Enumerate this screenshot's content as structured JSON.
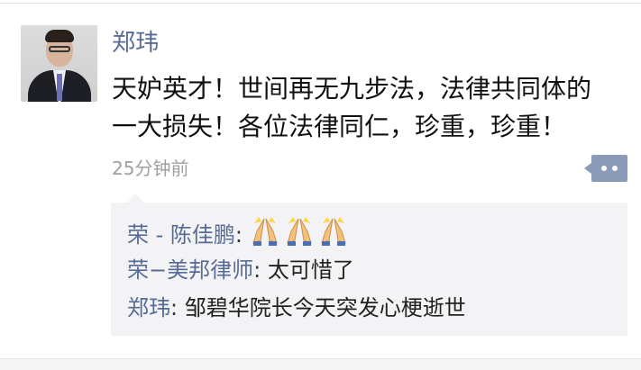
{
  "post": {
    "author": "郑玮",
    "text": "天妒英才！世间再无九步法，法律共同体的\n一大损失！各位法律同仁，珍重，珍重！",
    "time": "25分钟前"
  },
  "comments": [
    {
      "author": "荣 - 陈佳鹏",
      "separator": ": ",
      "text": "",
      "emoji_count": 3,
      "emoji": "folded-hands"
    },
    {
      "author": "荣−美邦律师",
      "separator": ": ",
      "text": "太可惜了"
    },
    {
      "author": "郑玮",
      "separator": ": ",
      "text": "邹碧华院长今天突发心梗逝世"
    }
  ],
  "colors": {
    "name_blue": "#576b95",
    "comment_bg": "#f3f3f5",
    "action_button": "#8a9bb8",
    "time_gray": "#a0a0a0"
  }
}
